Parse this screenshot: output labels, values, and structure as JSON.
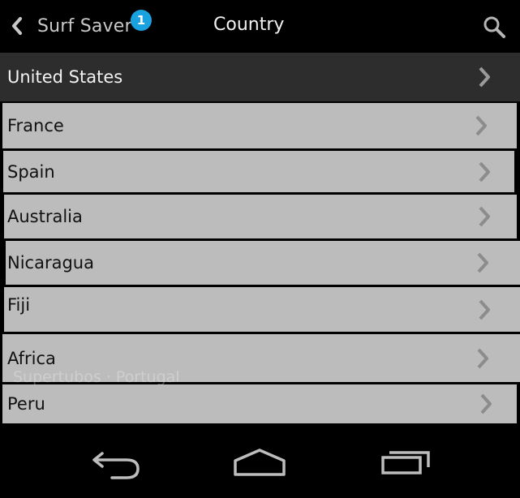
{
  "app_bar": {
    "app_name": "Surf Saver",
    "badge_count": "1",
    "title": "Country",
    "icons": {
      "back": "chevron-left-icon",
      "search": "search-icon"
    }
  },
  "countries": [
    {
      "label": "United States",
      "selected": true
    },
    {
      "label": "France"
    },
    {
      "label": "Spain"
    },
    {
      "label": "Australia"
    },
    {
      "label": "Nicaragua"
    },
    {
      "label": "Fiji"
    },
    {
      "label": "Africa"
    },
    {
      "label": "Peru"
    }
  ],
  "ghost_text": "Supertubos · Portugal",
  "nav_bar": {
    "icons": [
      "back-icon",
      "home-icon",
      "recent-apps-icon"
    ]
  },
  "colors": {
    "app_bar_bg": "#000000",
    "selected_row_bg": "#2d2d2d",
    "row_bg": "#bcbcbc",
    "badge": "#1aa1e0"
  }
}
